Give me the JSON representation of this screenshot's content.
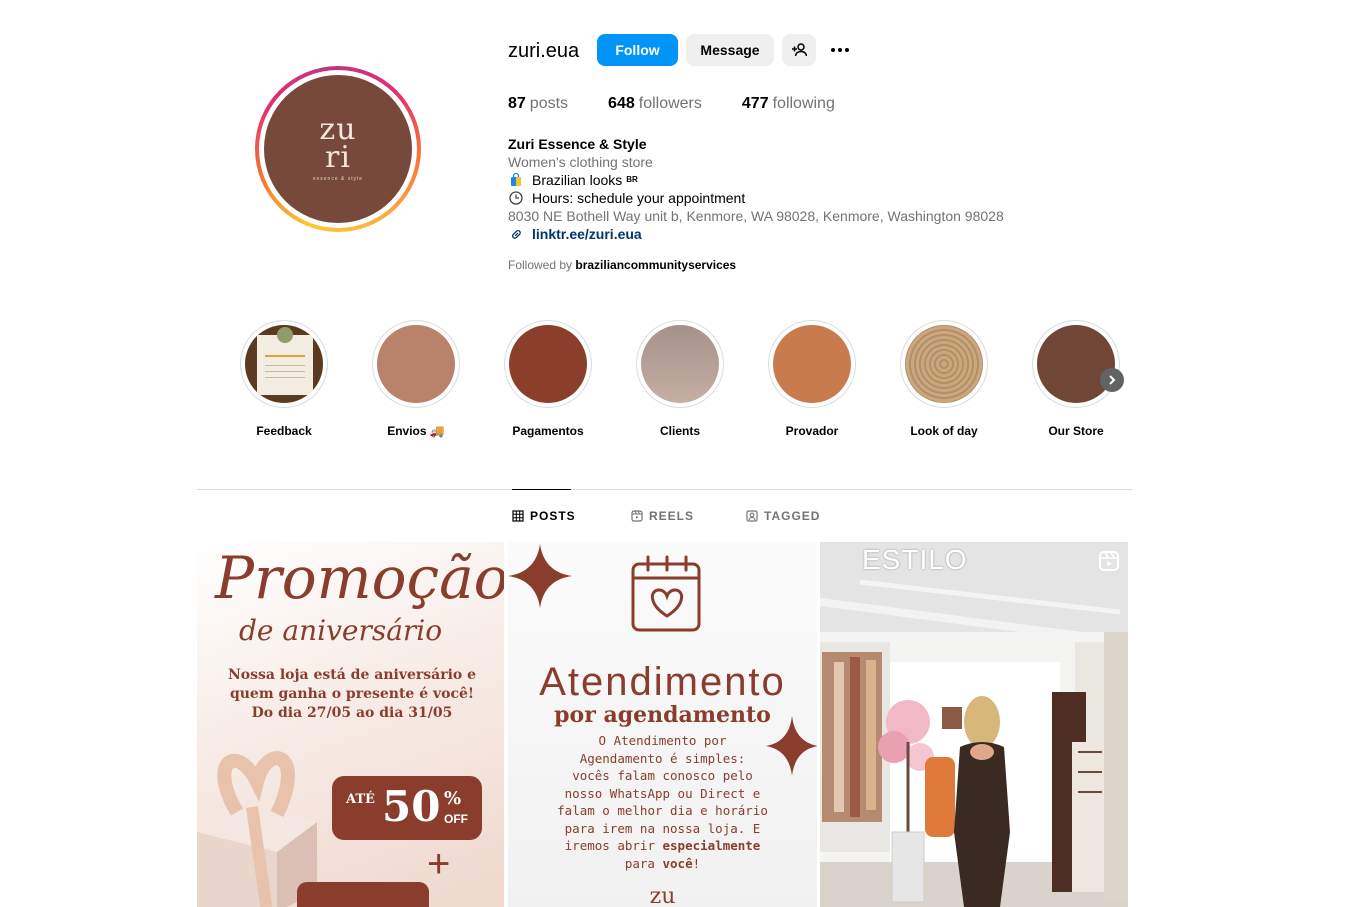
{
  "profile": {
    "username": "zuri.eua",
    "follow_label": "Follow",
    "message_label": "Message",
    "avatar_logo_top": "zu",
    "avatar_logo_bottom": "ri",
    "avatar_logo_sub": "essence & style",
    "stats": [
      {
        "value": "87",
        "label": "posts"
      },
      {
        "value": "648",
        "label": "followers"
      },
      {
        "value": "477",
        "label": "following"
      }
    ],
    "bio": {
      "name": "Zuri Essence & Style",
      "category": "Women's clothing store",
      "line1": "Brazilian looks",
      "line1_flag": "BR",
      "line2": "Hours: schedule your appointment",
      "address": "8030 NE Bothell Way unit b, Kenmore, WA 98028, Kenmore, Washington 98028",
      "link": "linktr.ee/zuri.eua"
    },
    "followed_by_prefix": "Followed by",
    "followed_by_user": "braziliancommunityservices"
  },
  "highlights": [
    {
      "label": "Feedback",
      "color": "#5a3b1f"
    },
    {
      "label": "Envios 🚚",
      "color": "#b9826b"
    },
    {
      "label": "Pagamentos",
      "color": "#8b3f2b"
    },
    {
      "label": "Clients",
      "color": "#b4a19a"
    },
    {
      "label": "Provador",
      "color": "#c87c4e"
    },
    {
      "label": "Look of day",
      "color": "#c9a77f"
    },
    {
      "label": "Our Store",
      "color": "#704737"
    }
  ],
  "tabs": [
    {
      "label": "POSTS",
      "active": true
    },
    {
      "label": "REELS",
      "active": false
    },
    {
      "label": "TAGGED",
      "active": false
    }
  ],
  "posts": {
    "p1": {
      "title": "Promoção",
      "subtitle": "de aniversário",
      "text1": "Nossa loja está de aniversário e",
      "text2": "quem ganha o presente é você!",
      "text3": "Do dia 27/05 ao dia 31/05",
      "ate": "ATÉ",
      "percent": "50",
      "percent_sign": "%",
      "off": "OFF"
    },
    "p2": {
      "title": "Atendimento",
      "subtitle": "por agendamento",
      "l1": "O Atendimento por",
      "l2": "Agendamento é simples:",
      "l3": "vocês falam conosco pelo",
      "l4": "nosso WhatsApp ou Direct e",
      "l5": "falam o melhor dia e horário",
      "l6": "para irem na nossa loja. E",
      "l7a": "iremos abrir",
      "l7b": "especialmente",
      "l8a": "para",
      "l8b": "você",
      "l8c": "!",
      "logo": "zu"
    },
    "p3": {
      "caption": "ESTILO"
    }
  },
  "colors": {
    "brand": "#76493a",
    "accent": "#8a3d2c",
    "follow_button": "#0095f6",
    "link": "#00376b"
  }
}
